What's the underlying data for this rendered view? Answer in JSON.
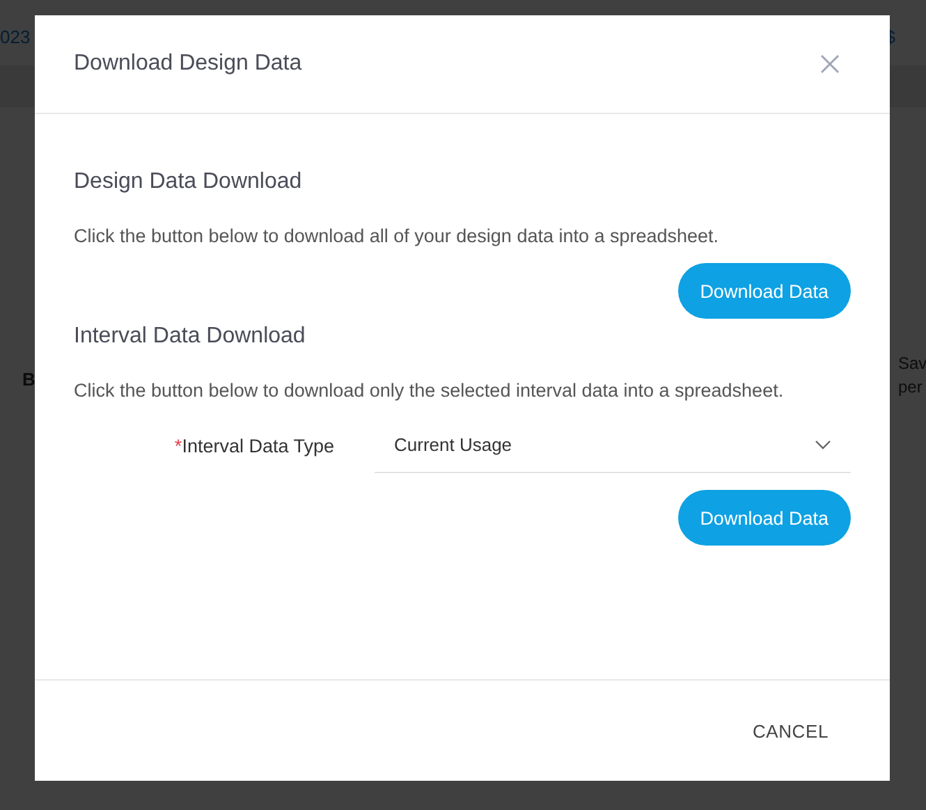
{
  "background": {
    "header_values": [
      "023",
      "$"
    ],
    "left_label": "B",
    "right_label": [
      "Sav",
      "per"
    ]
  },
  "dialog": {
    "title": "Download Design Data",
    "sections": [
      {
        "heading": "Design Data Download",
        "description": "Click the button below to download all of your design data into a spreadsheet.",
        "button": "Download Data"
      },
      {
        "heading": "Interval Data Download",
        "description": "Click the button below to download only the selected interval data into a spreadsheet.",
        "field": {
          "label": "Interval Data Type",
          "required_mark": "*",
          "value": "Current Usage"
        },
        "button": "Download Data"
      }
    ],
    "footer_button": "CANCEL"
  }
}
